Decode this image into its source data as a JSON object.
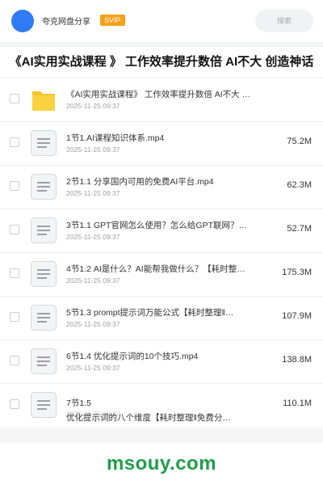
{
  "header": {
    "brand": "夸克网盘分享",
    "badge": "SVIP",
    "search_placeholder": "搜索"
  },
  "page_title": "《AI实用实战课程 》 工作效率提升数倍 AI不大 创造神话",
  "files": [
    {
      "icon": "folder-icon",
      "name": "《AI实用实战课程》 工作效率提升数倍 AI不大 …",
      "date": "2025-11-25 09:37",
      "size": ""
    },
    {
      "icon": "file-icon",
      "name": "1节1.AI课程知识体系.mp4",
      "date": "2025-11-25 09:37",
      "size": "75.2M"
    },
    {
      "icon": "file-icon",
      "name": "2节1.1 分享国内可用的免费AI平台.mp4",
      "date": "2025-11-25 09:37",
      "size": "62.3M"
    },
    {
      "icon": "file-icon",
      "name": "3节1.1 GPT官网怎么使用？怎么给GPT联网？…",
      "date": "2025-11-25 09:37",
      "size": "52.7M"
    },
    {
      "icon": "file-icon",
      "name": "4节1.2 AI是什么？AI能帮我做什么？【耗时整…",
      "date": "2025-11-25 09:37",
      "size": "175.3M"
    },
    {
      "icon": "file-icon",
      "name": "5节1.3 prompt提示词万能公式【耗时整理‖…",
      "date": "2025-11-25 09:37",
      "size": "107.9M"
    },
    {
      "icon": "file-icon",
      "name": "6节1.4 优化提示词的10个技巧.mp4",
      "date": "2025-11-25 09:37",
      "size": "138.8M"
    }
  ],
  "last_file": {
    "icon": "file-icon",
    "name_line1": "7节1.5",
    "name_line2": "优化提示词的八个维度【耗时整理‖免费分…",
    "date": "2025-11-25 09:37",
    "size": "110.1M"
  },
  "watermark": "msouy.com",
  "colors": {
    "accent": "#2f7bf5",
    "badge": "#f5a11a",
    "folder": "#f8c52c",
    "watermark": "#1f9d4a"
  }
}
